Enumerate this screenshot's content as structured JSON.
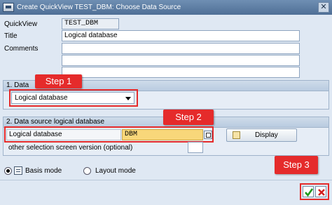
{
  "window": {
    "title": "Create QuickView TEST_DBM: Choose Data Source",
    "close_glyph": "✕"
  },
  "form": {
    "quickview_label": "QuickView",
    "quickview_value": "TEST_DBM",
    "title_label": "Title",
    "title_value": "Logical database",
    "comments_label": "Comments"
  },
  "group1": {
    "title": "1. Data",
    "select_value": "Logical database"
  },
  "group2": {
    "title": "2. Data source logical database",
    "ldb_label": "Logical database",
    "ldb_value": "DBM",
    "display_button": "Display",
    "other_selection_label": "other selection screen version (optional)"
  },
  "modes": {
    "basis_label": "Basis mode",
    "layout_label": "Layout mode",
    "selected": "basis"
  },
  "callouts": {
    "step1": "Step 1",
    "step2": "Step 2",
    "step3": "Step 3"
  },
  "colors": {
    "callout_red": "#e52b2b",
    "highlight_yellow": "#f8d77a",
    "window_bg": "#dfe8f3"
  }
}
